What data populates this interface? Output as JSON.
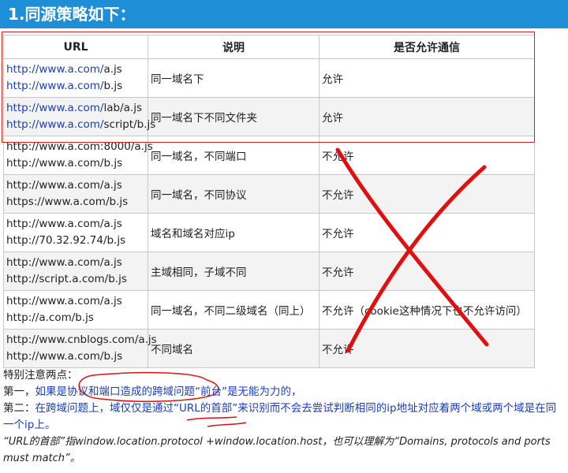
{
  "heading": "1.同源策略如下：",
  "table": {
    "headers": [
      "URL",
      "说明",
      "是否允许通信"
    ],
    "rows": [
      {
        "url1": {
          "pre": "http://www.a.com/",
          "post": "a.js",
          "blue": true
        },
        "url2": {
          "pre": "http://www.a.com/",
          "post": "b.js",
          "blue": true
        },
        "desc": "同一域名下",
        "allow": "允许"
      },
      {
        "url1": {
          "pre": "http://www.a.com/",
          "post": "lab/a.js",
          "blue": true
        },
        "url2": {
          "pre": "http://www.a.com/",
          "post": "script/b.js",
          "blue": true
        },
        "desc": "同一域名下不同文件夹",
        "allow": "允许"
      },
      {
        "url1": {
          "pre": "http://www.a.com:8000/a.js",
          "post": "",
          "blue": false
        },
        "url2": {
          "pre": "http://www.a.com/b.js",
          "post": "",
          "blue": false
        },
        "desc": "同一域名，不同端口",
        "allow": "不允许"
      },
      {
        "url1": {
          "pre": "http://www.a.com/a.js",
          "post": "",
          "blue": false
        },
        "url2": {
          "pre": "https://www.a.com/b.js",
          "post": "",
          "blue": false
        },
        "desc": "同一域名，不同协议",
        "allow": "不允许"
      },
      {
        "url1": {
          "pre": "http://www.a.com/a.js",
          "post": "",
          "blue": false
        },
        "url2": {
          "pre": "http://70.32.92.74/b.js",
          "post": "",
          "blue": false
        },
        "desc": "域名和域名对应ip",
        "allow": "不允许"
      },
      {
        "url1": {
          "pre": "http://www.a.com/a.js",
          "post": "",
          "blue": false
        },
        "url2": {
          "pre": "http://script.a.com/b.js",
          "post": "",
          "blue": false
        },
        "desc": "主域相同，子域不同",
        "allow": "不允许"
      },
      {
        "url1": {
          "pre": "http://www.a.com/a.js",
          "post": "",
          "blue": false
        },
        "url2": {
          "pre": "http://a.com/b.js",
          "post": "",
          "blue": false
        },
        "desc": "同一域名，不同二级域名（同上）",
        "allow": "不允许（cookie这种情况下也不允许访问）"
      },
      {
        "url1": {
          "pre": "http://www.cnblogs.com/a.js",
          "post": "",
          "blue": false
        },
        "url2": {
          "pre": "http://www.a.com/b.js",
          "post": "",
          "blue": false
        },
        "desc": "不同域名",
        "allow": "不允许"
      }
    ]
  },
  "notes": {
    "intro": "特别注意两点：",
    "first_prefix": "第一，",
    "first_text": "如果是协议和端口造成的跨域问题“前台”是无能为力的，",
    "second_prefix": "第二：",
    "second_text": "在跨域问题上，域仅仅是通过“URL的首部”来识别而不会去尝试判断相同的ip地址对应着两个域或两个域是在同一个ip上。",
    "footnote": "“URL的首部”指window.location.protocol +window.location.host，也可以理解为“Domains, protocols and ports must match”。"
  },
  "colors": {
    "banner": "#1e8fd6",
    "link_blue": "#1a3fb5",
    "annotation_red": "#e01010"
  }
}
